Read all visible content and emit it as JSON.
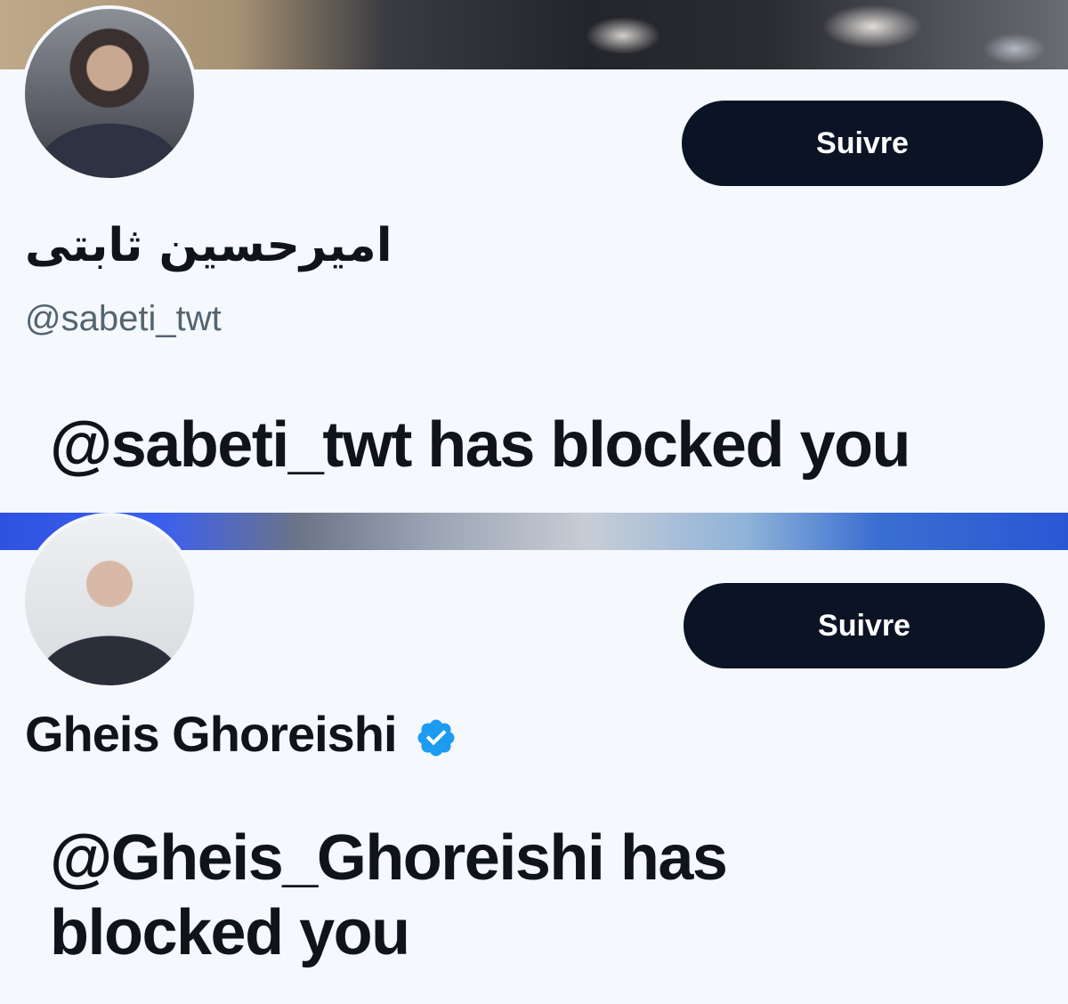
{
  "profiles": [
    {
      "display_name": "امیرحسین ثابتی",
      "handle": "@sabeti_twt",
      "follow_label": "Suivre",
      "blocked_message": "@sabeti_twt has blocked you",
      "verified": false
    },
    {
      "display_name": "Gheis Ghoreishi",
      "follow_label": "Suivre",
      "blocked_message": "@Gheis_Ghoreishi has blocked you",
      "verified": true,
      "verified_icon": "verified-badge-icon",
      "verified_color": "#1d9bf0"
    }
  ],
  "colors": {
    "button_bg": "#0b1424",
    "button_text": "#ffffff",
    "page_bg": "#f5f8fc",
    "handle_text": "#536471",
    "text": "#0f1419"
  }
}
